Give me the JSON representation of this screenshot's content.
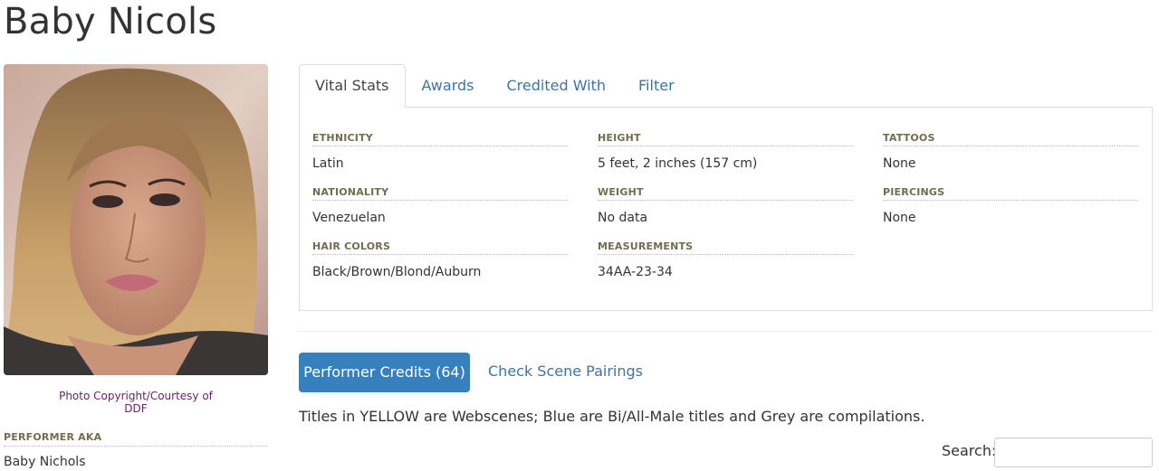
{
  "performer": {
    "name": "Baby Nicols",
    "photo_credit_line1": "Photo Copyright/Courtesy of",
    "photo_credit_line2": "DDF",
    "aka_heading": "PERFORMER AKA",
    "aka_value": "Baby Nichols"
  },
  "tabs": [
    {
      "label": "Vital Stats",
      "active": true
    },
    {
      "label": "Awards",
      "active": false
    },
    {
      "label": "Credited With",
      "active": false
    },
    {
      "label": "Filter",
      "active": false
    }
  ],
  "vital_stats": {
    "ethnicity": {
      "label": "ETHNICITY",
      "value": "Latin"
    },
    "nationality": {
      "label": "NATIONALITY",
      "value": "Venezuelan"
    },
    "hair_colors": {
      "label": "HAIR COLORS",
      "value": "Black/Brown/Blond/Auburn"
    },
    "height": {
      "label": "HEIGHT",
      "value": "5 feet, 2 inches (157 cm)"
    },
    "weight": {
      "label": "WEIGHT",
      "value": "No data"
    },
    "measurements": {
      "label": "MEASUREMENTS",
      "value": "34AA-23-34"
    },
    "tattoos": {
      "label": "TATTOOS",
      "value": "None"
    },
    "piercings": {
      "label": "PIERCINGS",
      "value": "None"
    }
  },
  "credits": {
    "button_label": "Performer Credits (64)",
    "pairings_link": "Check Scene Pairings",
    "legend_note": "Titles in YELLOW are Webscenes; Blue are Bi/All-Male titles and Grey are compilations.",
    "search_label": "Search:",
    "search_value": ""
  },
  "colors": {
    "link": "#3d74a8",
    "button": "#3780be",
    "label": "#6e6e50",
    "credit": "#6b1f6b"
  }
}
